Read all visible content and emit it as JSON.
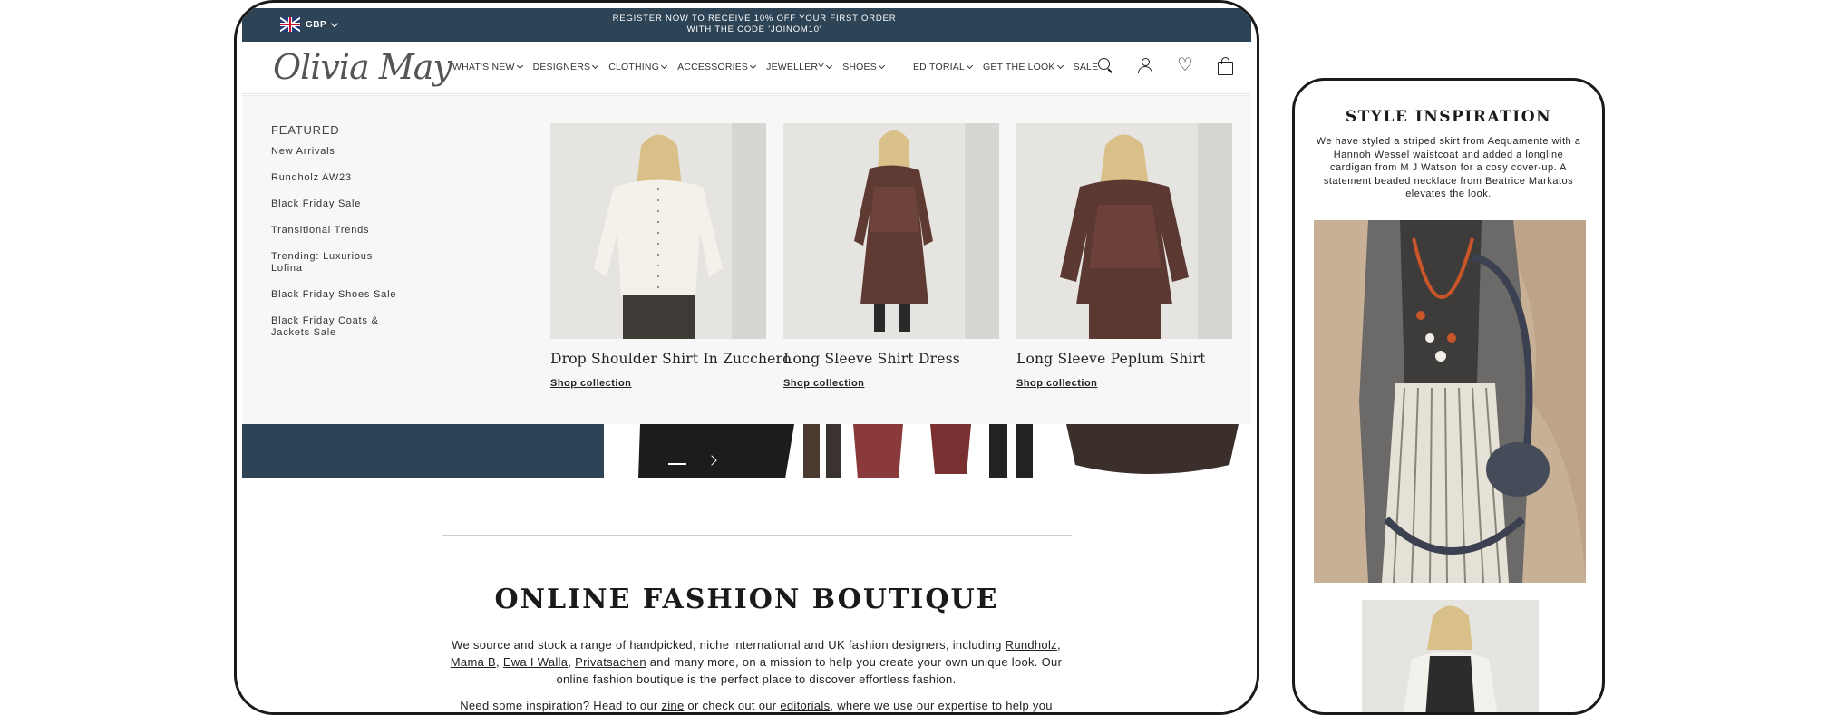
{
  "colors": {
    "brand_navy": "#2d4457",
    "text": "#222222",
    "menu_bg": "#f7f7f7"
  },
  "topbar": {
    "currency": "GBP",
    "promo": "REGISTER NOW TO RECEIVE 10% OFF YOUR FIRST ORDER WITH THE CODE 'JOINOM10'"
  },
  "header": {
    "logo": "Olivia May",
    "nav": [
      "WHAT'S NEW",
      "DESIGNERS",
      "CLOTHING",
      "ACCESSORIES",
      "JEWELLERY",
      "SHOES",
      "EDITORIAL",
      "GET THE LOOK",
      "SALE"
    ],
    "icons": [
      "search-icon",
      "account-icon",
      "heart-icon",
      "bag-icon"
    ]
  },
  "mega_menu": {
    "featured_title": "FEATURED",
    "links": [
      "New Arrivals",
      "Rundholz AW23",
      "Black Friday Sale",
      "Transitional Trends",
      "Trending: Luxurious Lofina",
      "Black Friday Shoes Sale",
      "Black Friday Coats & Jackets Sale"
    ],
    "cards": [
      {
        "title": "Drop Shoulder Shirt In Zucchero",
        "cta": "Shop collection"
      },
      {
        "title": "Long Sleeve Shirt Dress",
        "cta": "Shop collection"
      },
      {
        "title": "Long Sleeve Peplum Shirt",
        "cta": "Shop collection"
      }
    ]
  },
  "boutique": {
    "title": "ONLINE FASHION BOUTIQUE",
    "p1_a": "We source and stock a range of handpicked, niche international and UK fashion designers, including ",
    "link_rundholz": "Rundholz",
    "comma1": ", ",
    "link_mamab": "Mama B",
    "comma2": ", ",
    "link_ewa": "Ewa I Walla",
    "comma3": ", ",
    "link_privat": "Privatsachen",
    "p1_b": " and many more, on a mission to help you create your own unique look. Our online fashion boutique is the perfect place to discover effortless fashion.",
    "p2_a": "Need some inspiration? Head to our ",
    "link_zine": "zine",
    "p2_b": " or check out our ",
    "link_editorials": "editorials",
    "p2_c": ", where we use our expertise to help you"
  },
  "phone": {
    "title": "STYLE INSPIRATION",
    "text": "We have styled a striped skirt from Aequamente with a Hannoh Wessel waistcoat and added a longline cardigan from M J Watson for a cosy cover-up. A statement beaded necklace from Beatrice Markatos elevates the look."
  }
}
